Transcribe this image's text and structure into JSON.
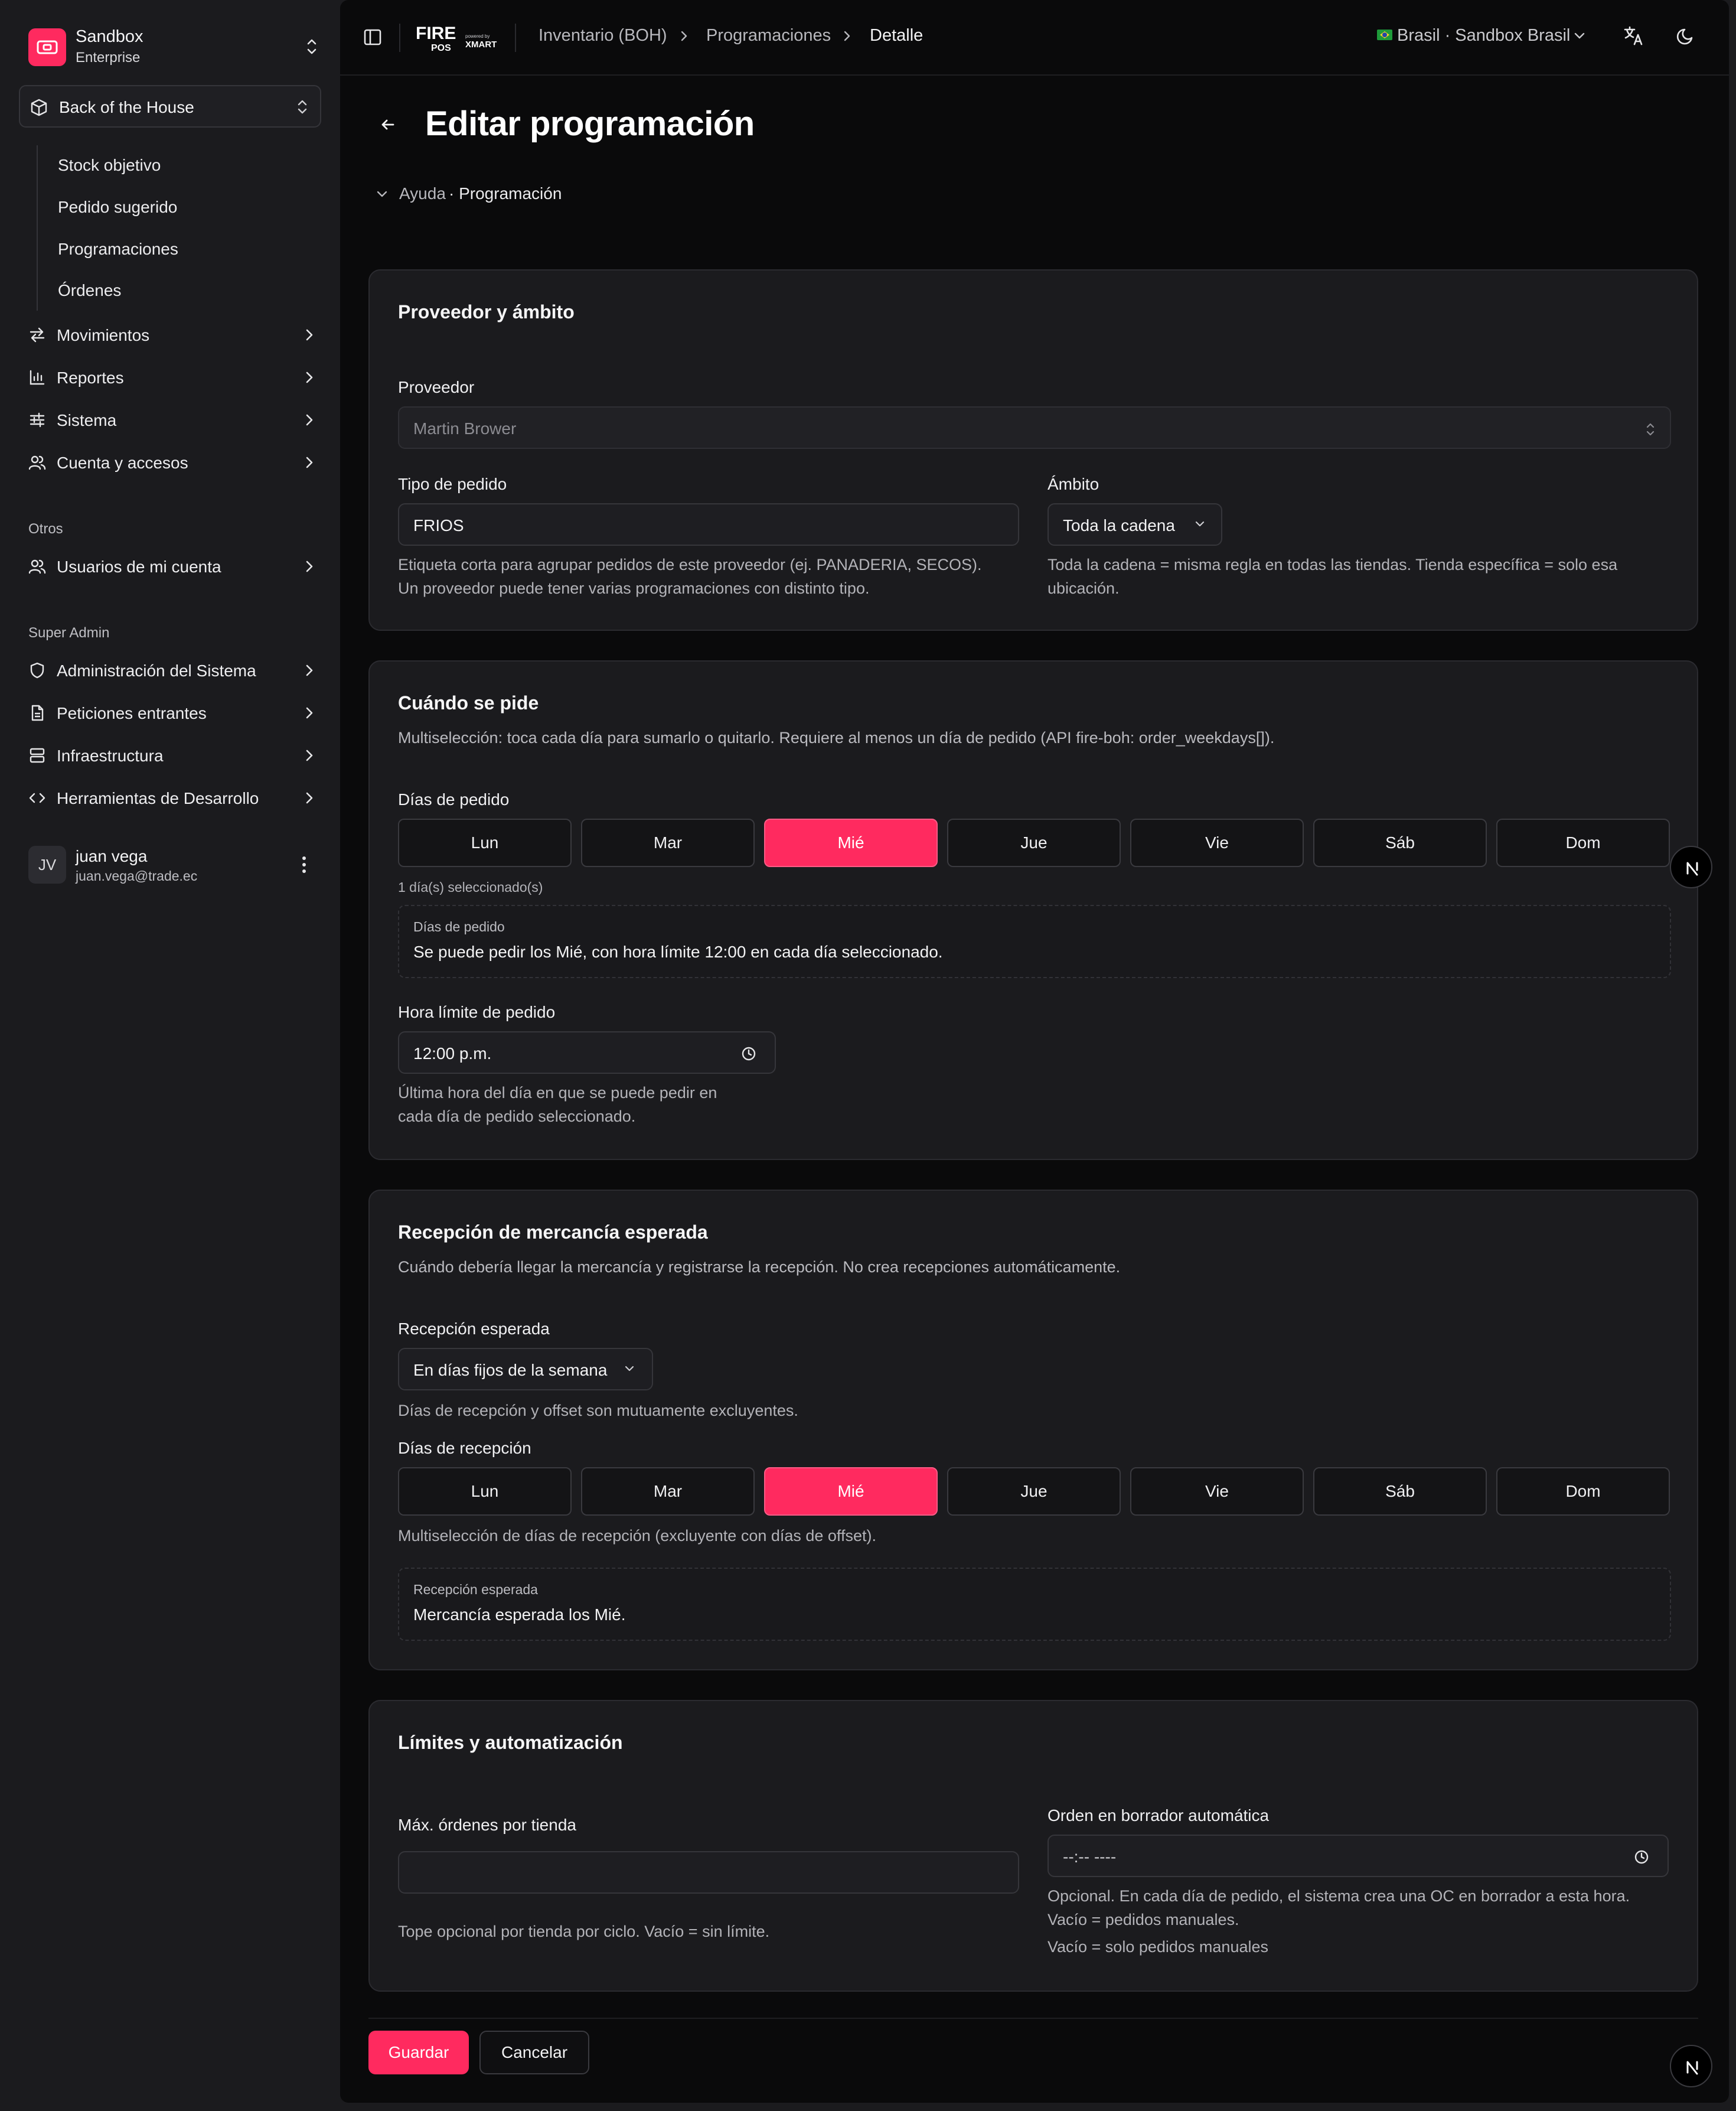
{
  "colors": {
    "accent": "#ff2a5f",
    "background": "#0a0a0b",
    "sidebar": "#1b1b1e",
    "card": "#1b1b1e"
  },
  "sidebar": {
    "org_name": "Sandbox",
    "org_plan": "Enterprise",
    "module": "Back of the House",
    "subitems": [
      "Stock objetivo",
      "Pedido sugerido",
      "Programaciones",
      "Órdenes"
    ],
    "items": [
      {
        "label": "Movimientos",
        "icon": "arrows-swap-icon"
      },
      {
        "label": "Reportes",
        "icon": "bar-chart-icon"
      },
      {
        "label": "Sistema",
        "icon": "sliders-icon"
      },
      {
        "label": "Cuenta y accesos",
        "icon": "users-icon"
      }
    ],
    "others_label": "Otros",
    "others": [
      {
        "label": "Usuarios de mi cuenta",
        "icon": "users-icon"
      }
    ],
    "superadmin_label": "Super Admin",
    "superadmin": [
      {
        "label": "Administración del Sistema",
        "icon": "shield-icon"
      },
      {
        "label": "Peticiones entrantes",
        "icon": "file-icon"
      },
      {
        "label": "Infraestructura",
        "icon": "server-icon"
      },
      {
        "label": "Herramientas de Desarrollo",
        "icon": "code-icon"
      }
    ],
    "user": {
      "initials": "JV",
      "name": "juan vega",
      "email": "juan.vega@trade.ec"
    }
  },
  "topbar": {
    "logo_fire": "FIRE",
    "logo_pos": "POS",
    "logo_powered": "powered by",
    "logo_xmart": "XMART",
    "breadcrumb": [
      "Inventario (BOH)",
      "Programaciones",
      "Detalle"
    ],
    "country": "Brasil · Sandbox Brasil"
  },
  "page": {
    "title": "Editar programación",
    "help_label": "Ayuda",
    "help_value": "· Programación"
  },
  "proveedor": {
    "title": "Proveedor y ámbito",
    "proveedor_label": "Proveedor",
    "proveedor_value": "Martin Brower",
    "tipo_label": "Tipo de pedido",
    "tipo_value": "FRIOS",
    "tipo_hint_1": "Etiqueta corta para agrupar pedidos de este proveedor (ej. PANADERIA, SECOS).",
    "tipo_hint_2": "Un proveedor puede tener varias programaciones con distinto tipo.",
    "ambito_label": "Ámbito",
    "ambito_value": "Toda la cadena",
    "ambito_hint_1": "Toda la cadena = misma regla en todas las tiendas. Tienda específica = solo esa",
    "ambito_hint_2": "ubicación."
  },
  "cuando": {
    "title": "Cuándo se pide",
    "desc": "Multiselección: toca cada día para sumarlo o quitarlo. Requiere al menos un día de pedido (API fire-boh: order_weekdays[]).",
    "dias_label": "Días de pedido",
    "days": [
      "Lun",
      "Mar",
      "Mié",
      "Jue",
      "Vie",
      "Sáb",
      "Dom"
    ],
    "selected": [
      2
    ],
    "count_text": "1 día(s) seleccionado(s)",
    "summary_label": "Días de pedido",
    "summary_text": "Se puede pedir los Mié, con hora límite 12:00 en cada día seleccionado.",
    "hora_label": "Hora límite de pedido",
    "hora_value": "12:00 p.m.",
    "hora_hint_1": "Última hora del día en que se puede pedir en",
    "hora_hint_2": "cada día de pedido seleccionado."
  },
  "recepcion": {
    "title": "Recepción de mercancía esperada",
    "desc": "Cuándo debería llegar la mercancía y registrarse la recepción. No crea recepciones automáticamente.",
    "esperada_label": "Recepción esperada",
    "esperada_value": "En días fijos de la semana",
    "esperada_hint": "Días de recepción y offset son mutuamente excluyentes.",
    "dias_label": "Días de recepción",
    "days": [
      "Lun",
      "Mar",
      "Mié",
      "Jue",
      "Vie",
      "Sáb",
      "Dom"
    ],
    "selected": [
      2
    ],
    "dias_hint": "Multiselección de días de recepción (excluyente con días de offset).",
    "summary_label": "Recepción esperada",
    "summary_text": "Mercancía esperada los Mié."
  },
  "limites": {
    "title": "Límites y automatización",
    "max_label": "Máx. órdenes por tienda",
    "max_value": "",
    "max_hint": "Tope opcional por tienda por ciclo. Vacío = sin límite.",
    "borrador_label": "Orden en borrador automática",
    "borrador_value": "--:-- ----",
    "borrador_hint_1": "Opcional. En cada día de pedido, el sistema crea una OC en borrador a esta hora.",
    "borrador_hint_2": "Vacío = pedidos manuales.",
    "borrador_hint_3": "Vacío = solo pedidos manuales"
  },
  "actions": {
    "save": "Guardar",
    "cancel": "Cancelar"
  }
}
